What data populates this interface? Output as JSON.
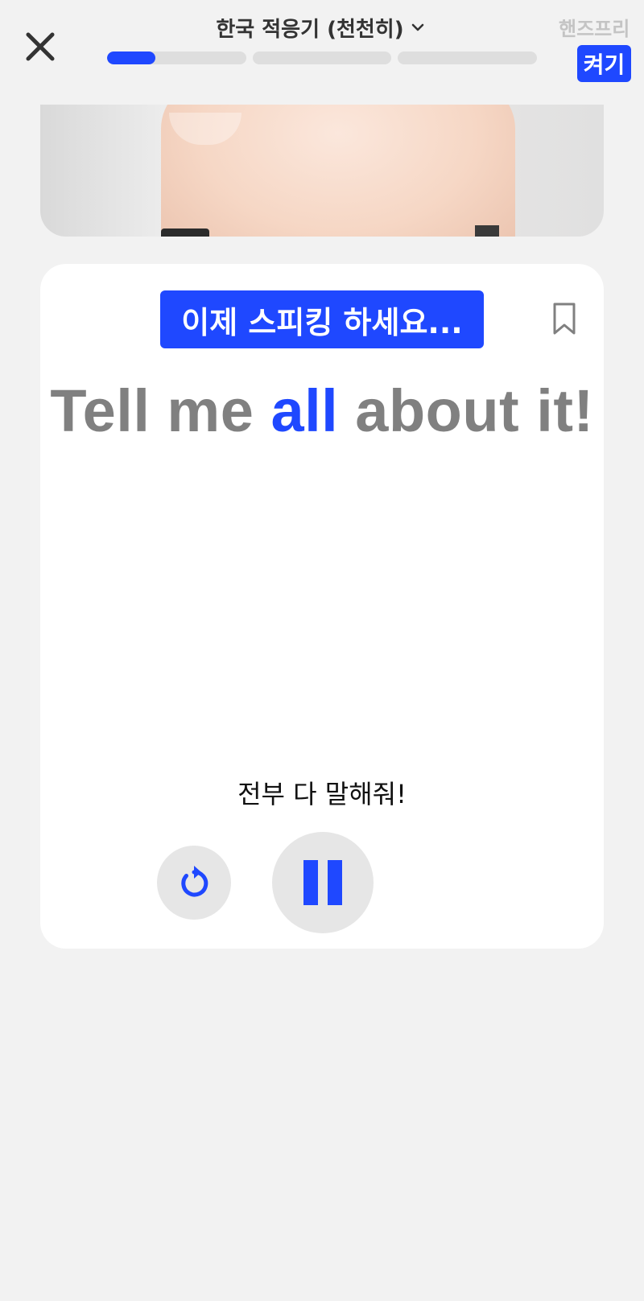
{
  "header": {
    "title": "한국 적응기 (천천히)",
    "handsfree_label": "핸즈프리",
    "toggle_label": "켜기",
    "progress": [
      0.35,
      0,
      0
    ]
  },
  "card": {
    "speak_prompt": "이제 스피킹 하세요...",
    "sentence_before": "Tell me ",
    "sentence_highlight": "all",
    "sentence_after": " about it!",
    "translation": "전부 다 말해줘!"
  },
  "colors": {
    "accent": "#1f48ff",
    "background": "#f2f2f2",
    "sentence_gray": "#808080"
  },
  "icons": [
    "close-icon",
    "chevron-down-icon",
    "bookmark-icon",
    "replay-icon",
    "pause-icon"
  ]
}
